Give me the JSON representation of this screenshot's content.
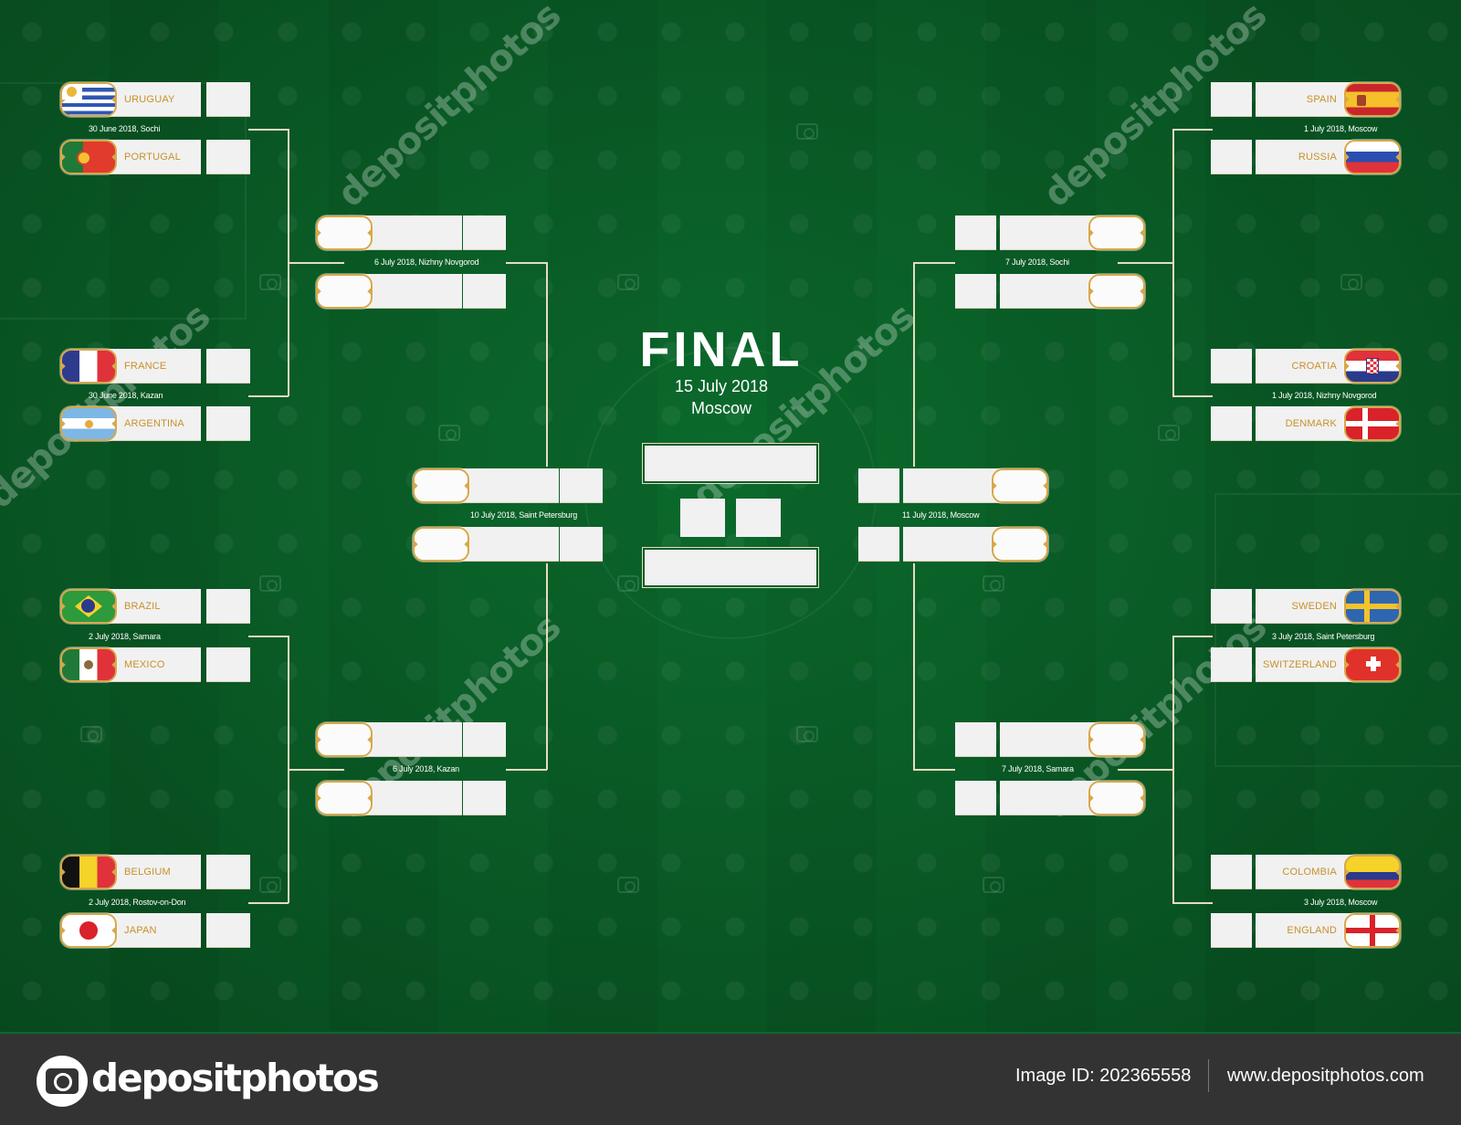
{
  "title": {
    "heading": "FINAL",
    "date": "15 July 2018",
    "city": "Moscow"
  },
  "colors": {
    "background": "#0a5c26",
    "team_label": "#c8902b",
    "flag_frame": "#d9a74a",
    "connector": "#e6dcc0",
    "footer": "#333333"
  },
  "round_of_16": {
    "left": [
      {
        "team_a": "URUGUAY",
        "flag_a": "uruguay-flag",
        "team_b": "PORTUGAL",
        "flag_b": "portugal-flag",
        "date": "30 June 2018, Sochi"
      },
      {
        "team_a": "FRANCE",
        "flag_a": "france-flag",
        "team_b": "ARGENTINA",
        "flag_b": "argentina-flag",
        "date": "30 June 2018, Kazan"
      },
      {
        "team_a": "BRAZIL",
        "flag_a": "brazil-flag",
        "team_b": "MEXICO",
        "flag_b": "mexico-flag",
        "date": "2 July 2018, Samara"
      },
      {
        "team_a": "BELGIUM",
        "flag_a": "belgium-flag",
        "team_b": "JAPAN",
        "flag_b": "japan-flag",
        "date": "2 July 2018, Rostov-on-Don"
      }
    ],
    "right": [
      {
        "team_a": "SPAIN",
        "flag_a": "spain-flag",
        "team_b": "RUSSIA",
        "flag_b": "russia-flag",
        "date": "1 July 2018, Moscow"
      },
      {
        "team_a": "CROATIA",
        "flag_a": "croatia-flag",
        "team_b": "DENMARK",
        "flag_b": "denmark-flag",
        "date": "1 July 2018, Nizhny Novgorod"
      },
      {
        "team_a": "SWEDEN",
        "flag_a": "sweden-flag",
        "team_b": "SWITZERLAND",
        "flag_b": "switzerland-flag",
        "date": "3 July 2018, Saint Petersburg"
      },
      {
        "team_a": "COLOMBIA",
        "flag_a": "colombia-flag",
        "team_b": "ENGLAND",
        "flag_b": "england-flag",
        "date": "3 July 2018, Moscow"
      }
    ]
  },
  "quarter_finals": {
    "left": [
      {
        "date": "6 July 2018, Nizhny Novgorod"
      },
      {
        "date": "6 July 2018, Kazan"
      }
    ],
    "right": [
      {
        "date": "7 July 2018, Sochi"
      },
      {
        "date": "7 July 2018, Samara"
      }
    ]
  },
  "semi_finals": {
    "left": {
      "date": "10 July 2018, Saint Petersburg"
    },
    "right": {
      "date": "11 July 2018, Moscow"
    }
  },
  "watermark": {
    "text": "depositphotos"
  },
  "footer": {
    "logo_text": "depositphotos",
    "image_id": "Image ID: 202365558",
    "url": "www.depositphotos.com"
  }
}
